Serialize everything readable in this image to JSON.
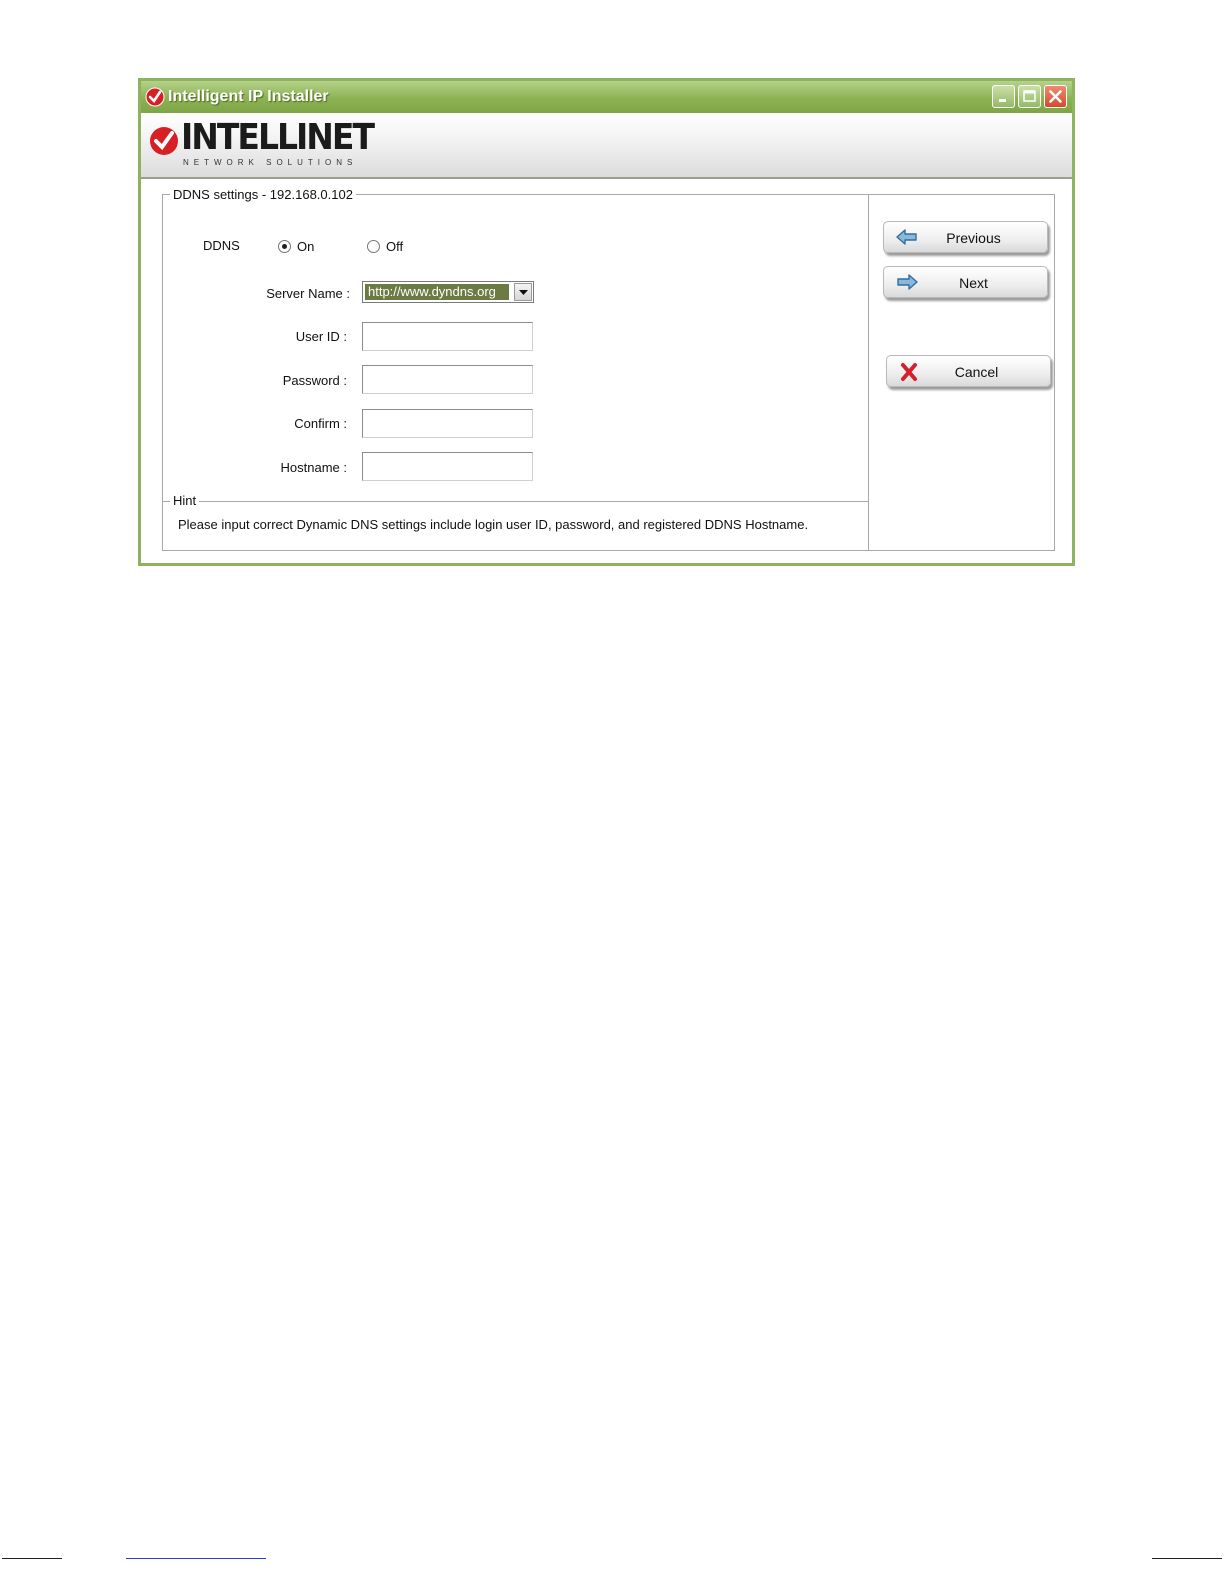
{
  "window": {
    "title": "Intelligent IP Installer",
    "accent_color": "#8cb253",
    "controls": [
      "minimize-icon",
      "maximize-icon",
      "close-icon"
    ]
  },
  "banner": {
    "logo_text": "INTELLINET",
    "logo_subtext": "NETWORK SOLUTIONS",
    "logo_color": "#d91f26"
  },
  "settings": {
    "group_title": "DDNS settings - 192.168.0.102",
    "ddns_label": "DDNS",
    "radio_on_label": "On",
    "radio_off_label": "Off",
    "ddns_selected": "On",
    "server_name_label": "Server Name :",
    "server_name_value": "http://www.dyndns.org",
    "user_id_label": "User ID :",
    "user_id_value": "",
    "password_label": "Password :",
    "password_value": "",
    "confirm_label": "Confirm :",
    "confirm_value": "",
    "hostname_label": "Hostname :",
    "hostname_value": ""
  },
  "hint": {
    "title": "Hint",
    "text": "Please input correct Dynamic DNS settings include login user ID, password, and registered DDNS Hostname."
  },
  "buttons": {
    "previous_label": "Previous",
    "next_label": "Next",
    "cancel_label": "Cancel"
  }
}
